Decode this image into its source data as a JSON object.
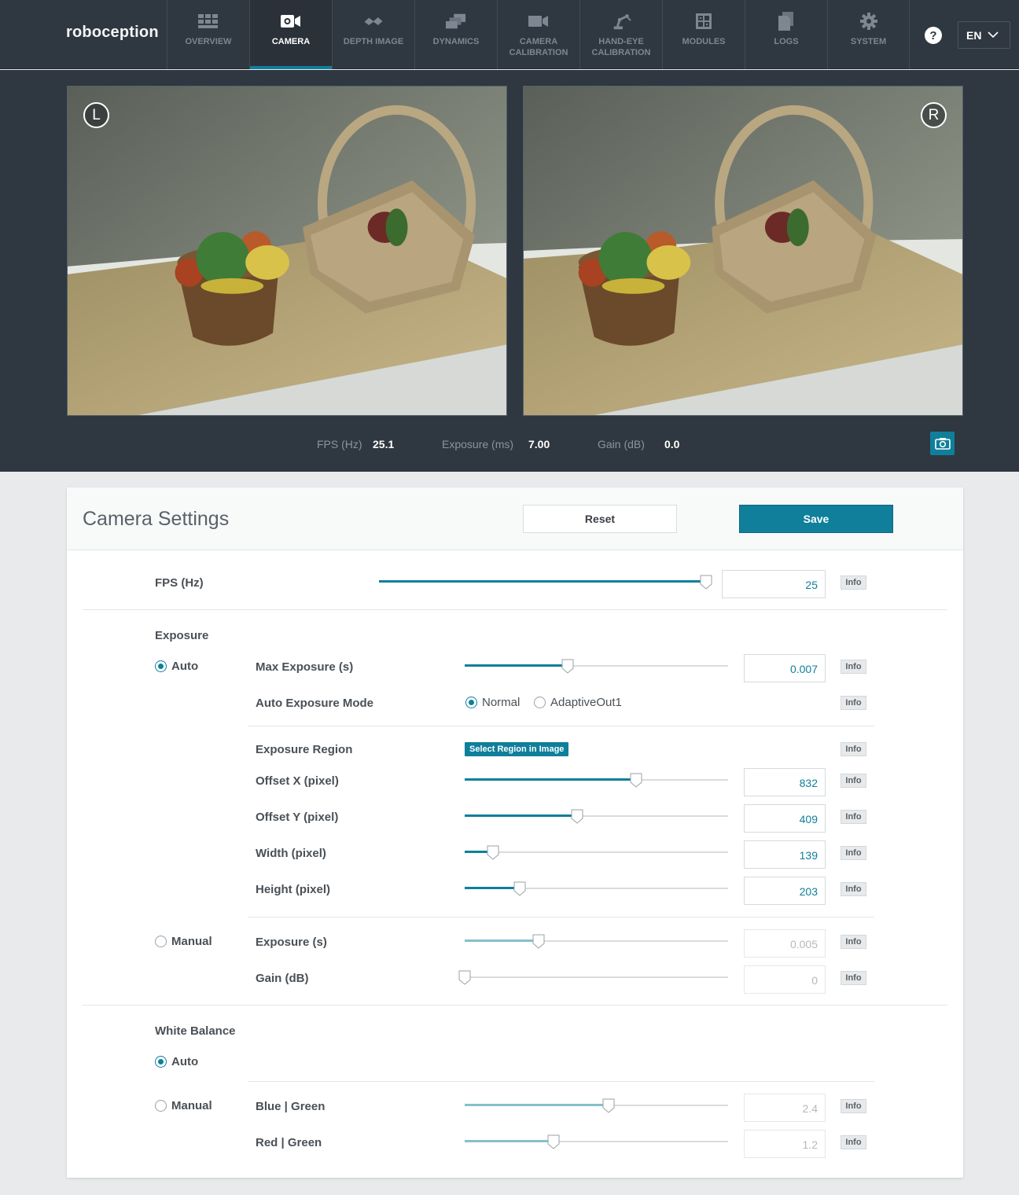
{
  "brand": {
    "logo_text": "roboception"
  },
  "nav": {
    "items": [
      {
        "label": "OVERVIEW",
        "icon": "grid-icon",
        "active": false
      },
      {
        "label": "CAMERA",
        "icon": "camera-icon",
        "active": true
      },
      {
        "label": "DEPTH IMAGE",
        "icon": "depth-icon",
        "active": false
      },
      {
        "label": "DYNAMICS",
        "icon": "dynamics-icon",
        "active": false
      },
      {
        "label": "CAMERA\nCALIBRATION",
        "icon": "calibration-icon",
        "active": false
      },
      {
        "label": "HAND-EYE\nCALIBRATION",
        "icon": "robot-arm-icon",
        "active": false
      },
      {
        "label": "MODULES",
        "icon": "modules-icon",
        "active": false
      },
      {
        "label": "LOGS",
        "icon": "document-icon",
        "active": false
      },
      {
        "label": "SYSTEM",
        "icon": "gear-icon",
        "active": false
      }
    ],
    "help_symbol": "?",
    "language": "EN"
  },
  "viewer": {
    "left_badge": "L",
    "right_badge": "R",
    "stats": {
      "fps_label": "FPS (Hz)",
      "fps_value": "25.1",
      "exposure_label": "Exposure (ms)",
      "exposure_value": "7.00",
      "gain_label": "Gain (dB)",
      "gain_value": "0.0"
    }
  },
  "settings": {
    "title": "Camera Settings",
    "reset_label": "Reset",
    "save_label": "Save",
    "info_label": "Info",
    "fps": {
      "label": "FPS (Hz)",
      "value": "25",
      "fraction": 1.0
    },
    "exposure": {
      "title": "Exposure",
      "auto_label": "Auto",
      "manual_label": "Manual",
      "mode": "auto",
      "max_exposure": {
        "label": "Max Exposure (s)",
        "value": "0.007",
        "fraction": 0.39
      },
      "auto_mode": {
        "label": "Auto Exposure Mode",
        "options": [
          "Normal",
          "AdaptiveOut1"
        ],
        "selected": "Normal"
      },
      "region": {
        "label": "Exposure Region",
        "button_label": "Select Region in Image"
      },
      "offset_x": {
        "label": "Offset X (pixel)",
        "value": "832",
        "fraction": 0.65
      },
      "offset_y": {
        "label": "Offset Y (pixel)",
        "value": "409",
        "fraction": 0.427
      },
      "width": {
        "label": "Width (pixel)",
        "value": "139",
        "fraction": 0.108
      },
      "height": {
        "label": "Height (pixel)",
        "value": "203",
        "fraction": 0.21
      },
      "manual_exposure": {
        "label": "Exposure (s)",
        "value": "0.005",
        "fraction": 0.28
      },
      "manual_gain": {
        "label": "Gain (dB)",
        "value": "0",
        "fraction": 0.0
      }
    },
    "white_balance": {
      "title": "White Balance",
      "auto_label": "Auto",
      "manual_label": "Manual",
      "mode": "auto",
      "blue_green": {
        "label": "Blue | Green",
        "value": "2.4",
        "fraction": 0.545
      },
      "red_green": {
        "label": "Red | Green",
        "value": "1.2",
        "fraction": 0.336
      }
    }
  },
  "colors": {
    "accent": "#0f7f9b",
    "nav_bg": "#2f3740",
    "page_bg": "#e8eaeb"
  }
}
